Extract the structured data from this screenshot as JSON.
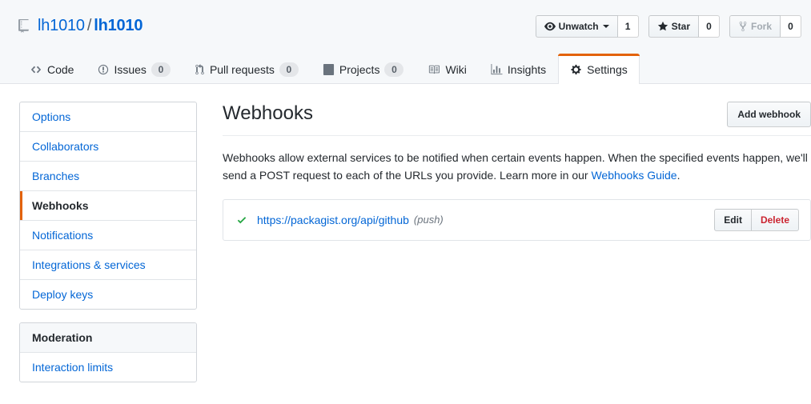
{
  "header": {
    "repo_icon": "repo-book-icon",
    "owner": "lh1010",
    "separator": "/",
    "repo_name": "lh1010",
    "actions": [
      {
        "name": "watch",
        "icon": "eye-icon",
        "label": "Unwatch",
        "has_caret": true,
        "count": "1",
        "disabled": false
      },
      {
        "name": "star",
        "icon": "star-icon",
        "label": "Star",
        "has_caret": false,
        "count": "0",
        "disabled": false
      },
      {
        "name": "fork",
        "icon": "fork-icon",
        "label": "Fork",
        "has_caret": false,
        "count": "0",
        "disabled": true
      }
    ],
    "tabs": [
      {
        "name": "code",
        "icon": "code-icon",
        "label": "Code",
        "count": null,
        "selected": false
      },
      {
        "name": "issues",
        "icon": "issue-opened-icon",
        "label": "Issues",
        "count": "0",
        "selected": false
      },
      {
        "name": "pull-requests",
        "icon": "git-pull-request-icon",
        "label": "Pull requests",
        "count": "0",
        "selected": false
      },
      {
        "name": "projects",
        "icon": "project-board-icon",
        "label": "Projects",
        "count": "0",
        "selected": false
      },
      {
        "name": "wiki",
        "icon": "book-icon",
        "label": "Wiki",
        "count": null,
        "selected": false
      },
      {
        "name": "insights",
        "icon": "graph-bar-icon",
        "label": "Insights",
        "count": null,
        "selected": false
      },
      {
        "name": "settings",
        "icon": "gear-icon",
        "label": "Settings",
        "count": null,
        "selected": true
      }
    ]
  },
  "sidebar": {
    "groups": [
      {
        "heading": null,
        "items": [
          {
            "name": "options",
            "label": "Options",
            "selected": false
          },
          {
            "name": "collaborators",
            "label": "Collaborators",
            "selected": false
          },
          {
            "name": "branches",
            "label": "Branches",
            "selected": false
          },
          {
            "name": "webhooks",
            "label": "Webhooks",
            "selected": true
          },
          {
            "name": "notifications",
            "label": "Notifications",
            "selected": false
          },
          {
            "name": "integrations-services",
            "label": "Integrations & services",
            "selected": false
          },
          {
            "name": "deploy-keys",
            "label": "Deploy keys",
            "selected": false
          }
        ]
      },
      {
        "heading": "Moderation",
        "items": [
          {
            "name": "interaction-limits",
            "label": "Interaction limits",
            "selected": false
          }
        ]
      }
    ]
  },
  "main": {
    "title": "Webhooks",
    "add_button_label": "Add webhook",
    "description_part1": "Webhooks allow external services to be notified when certain events happen. When the specified events happen, we'll send a POST request to each of the URLs you provide. Learn more in our ",
    "description_link": "Webhooks Guide",
    "description_part2": ".",
    "hooks": [
      {
        "status_icon": "check-icon",
        "status_color": "#28a745",
        "url": "https://packagist.org/api/github",
        "events": "(push)",
        "edit_label": "Edit",
        "delete_label": "Delete"
      }
    ]
  },
  "colors": {
    "accent_orange": "#e36209",
    "link_blue": "#0366d6",
    "danger_red": "#cb2431",
    "success_green": "#28a745",
    "header_bg": "#f6f8fa"
  }
}
